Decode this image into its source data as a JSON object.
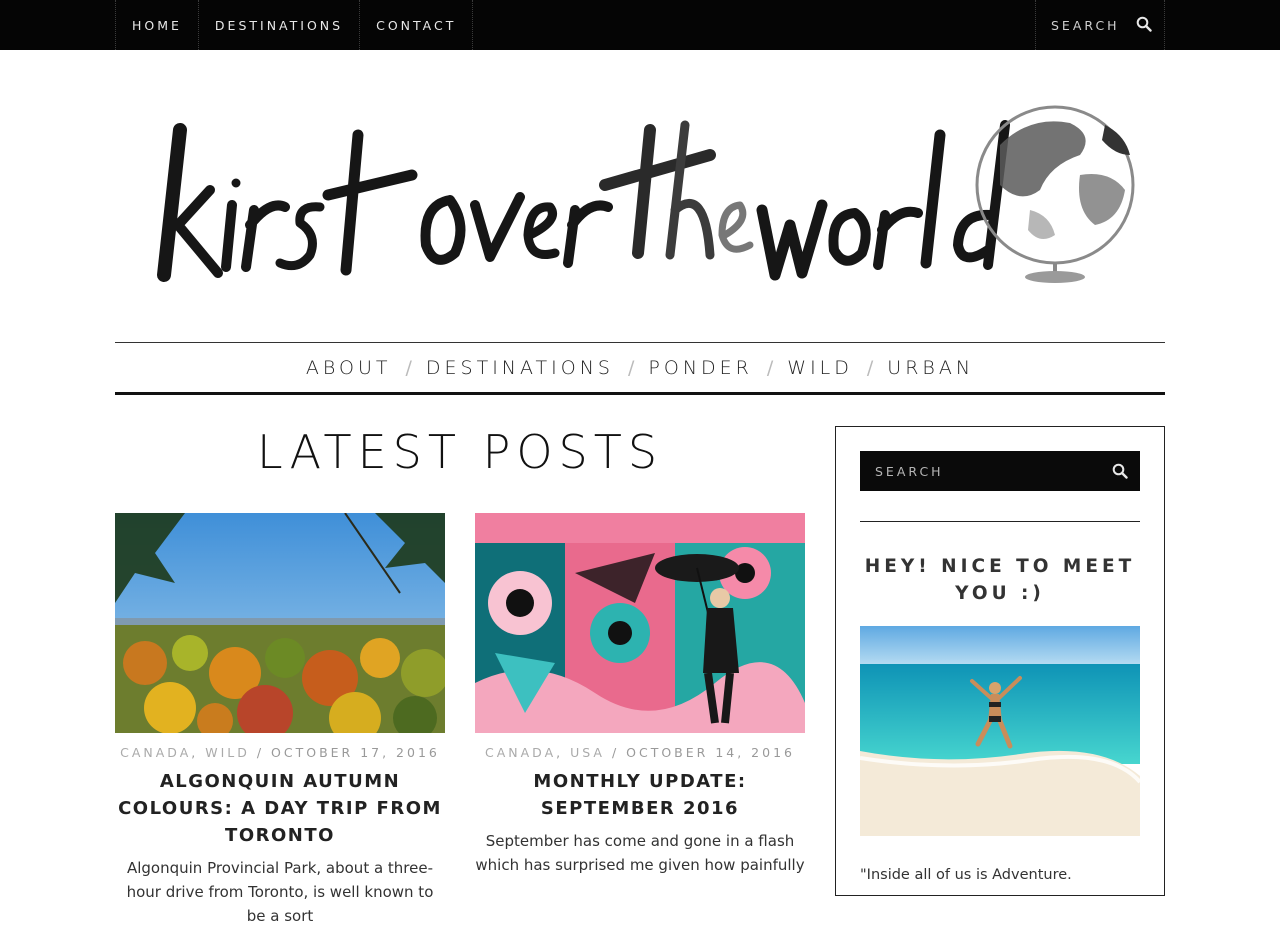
{
  "topbar": {
    "nav": [
      "HOME",
      "DESTINATIONS",
      "CONTACT"
    ],
    "search_placeholder": "SEARCH"
  },
  "logo": {
    "text": "kirst over the world"
  },
  "mainnav": {
    "items": [
      "ABOUT",
      "DESTINATIONS",
      "PONDER",
      "WILD",
      "URBAN"
    ],
    "separator": "/"
  },
  "latest": {
    "title": "LATEST POSTS",
    "posts": [
      {
        "categories": [
          "CANADA",
          "WILD"
        ],
        "date": "OCTOBER 17, 2016",
        "title": "ALGONQUIN AUTUMN COLOURS: A DAY TRIP FROM TORONTO",
        "excerpt": "Algonquin Provincial Park, about a three-hour drive from Toronto, is well known to be a sort"
      },
      {
        "categories": [
          "CANADA",
          "USA"
        ],
        "date": "OCTOBER 14, 2016",
        "title": "MONTHLY UPDATE: SEPTEMBER 2016",
        "excerpt": "September has come and gone in a flash which has surprised me given how painfully"
      }
    ]
  },
  "sidebar": {
    "search_placeholder": "SEARCH",
    "heading": "HEY! NICE TO MEET YOU :)",
    "quote": "\"Inside all of us is Adventure."
  },
  "colors": {
    "topbar_bg": "#050505",
    "text": "#222222",
    "meta": "#999999"
  },
  "icons": {
    "search": "search-icon"
  }
}
